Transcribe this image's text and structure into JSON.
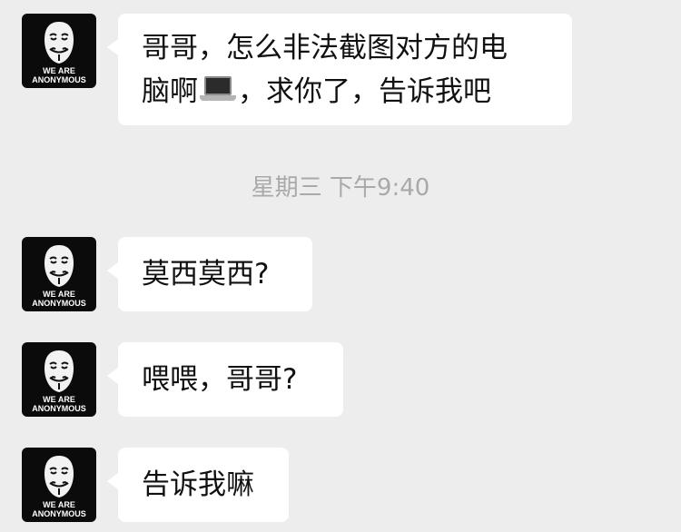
{
  "avatar": {
    "text_line1": "WE ARE",
    "text_line2": "ANONYMOUS",
    "icon": "guy-fawkes-mask-icon"
  },
  "messages": [
    {
      "lines": [
        "哥哥，怎么非法截图对方的电",
        "脑啊",
        "，求你了，告诉我吧"
      ],
      "emoji": "laptop-icon"
    },
    {
      "text": "莫西莫西?"
    },
    {
      "text": "喂喂，哥哥?"
    },
    {
      "text": "告诉我嘛"
    }
  ],
  "timestamp": "星期三 下午9:40",
  "colors": {
    "background": "#ededed",
    "bubble": "#ffffff",
    "timestamp_text": "#a9a9a9",
    "avatar_bg": "#0b0b0b"
  }
}
